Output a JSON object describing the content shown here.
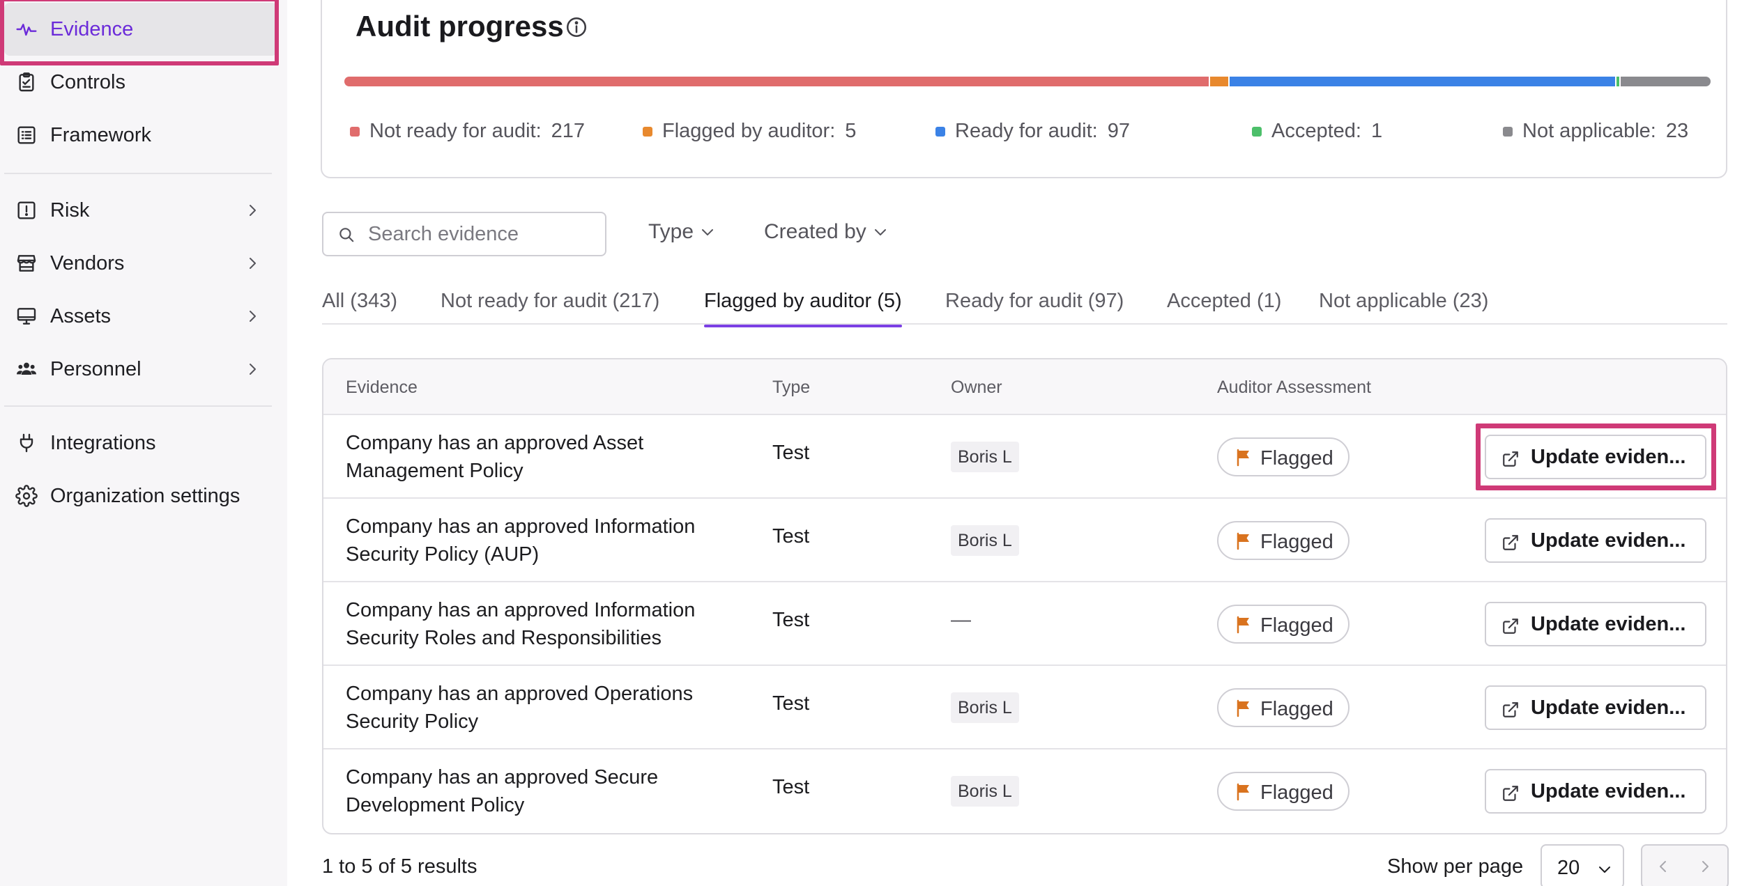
{
  "sidebar": {
    "items": [
      {
        "label": "Evidence",
        "icon": "activity-icon",
        "active": true
      },
      {
        "label": "Controls",
        "icon": "clipboard-check-icon"
      },
      {
        "label": "Framework",
        "icon": "list-grid-icon"
      },
      {
        "label": "Risk",
        "icon": "alert-square-icon",
        "has_chevron": true
      },
      {
        "label": "Vendors",
        "icon": "store-icon",
        "has_chevron": true
      },
      {
        "label": "Assets",
        "icon": "monitor-icon",
        "has_chevron": true
      },
      {
        "label": "Personnel",
        "icon": "users-icon",
        "has_chevron": true
      },
      {
        "label": "Integrations",
        "icon": "plug-icon"
      },
      {
        "label": "Organization settings",
        "icon": "gear-icon"
      }
    ]
  },
  "audit": {
    "title": "Audit progress",
    "legend": [
      {
        "label": "Not ready for audit:",
        "value": "217",
        "count": 217,
        "color": "#e06c6c"
      },
      {
        "label": "Flagged by auditor:",
        "value": "5",
        "count": 5,
        "color": "#e8892e"
      },
      {
        "label": "Ready for audit:",
        "value": "97",
        "count": 97,
        "color": "#3b82e6"
      },
      {
        "label": "Accepted:",
        "value": "1",
        "count": 1,
        "color": "#4cbf6a"
      },
      {
        "label": "Not applicable:",
        "value": "23",
        "count": 23,
        "color": "#8a8a8e"
      }
    ]
  },
  "filters": {
    "search_placeholder": "Search evidence",
    "type_label": "Type",
    "created_by_label": "Created by"
  },
  "tabs": [
    {
      "label": "All (343)"
    },
    {
      "label": "Not ready for audit (217)"
    },
    {
      "label": "Flagged by auditor (5)",
      "active": true
    },
    {
      "label": "Ready for audit (97)"
    },
    {
      "label": "Accepted (1)"
    },
    {
      "label": "Not applicable (23)"
    }
  ],
  "table": {
    "columns": [
      "Evidence",
      "Type",
      "Owner",
      "Auditor Assessment"
    ],
    "rows": [
      {
        "evidence": "Company has an approved Asset Management Policy",
        "type": "Test",
        "owner": "Boris L",
        "assessment": "Flagged",
        "action": "Update eviden..."
      },
      {
        "evidence": "Company has an approved Information Security Policy (AUP)",
        "type": "Test",
        "owner": "Boris L",
        "assessment": "Flagged",
        "action": "Update eviden..."
      },
      {
        "evidence": "Company has an approved Information Security Roles and Responsibilities",
        "type": "Test",
        "owner": "—",
        "assessment": "Flagged",
        "action": "Update eviden..."
      },
      {
        "evidence": "Company has an approved Operations Security Policy",
        "type": "Test",
        "owner": "Boris L",
        "assessment": "Flagged",
        "action": "Update eviden..."
      },
      {
        "evidence": "Company has an approved Secure Development Policy",
        "type": "Test",
        "owner": "Boris L",
        "assessment": "Flagged",
        "action": "Update eviden..."
      }
    ]
  },
  "footer": {
    "results": "1 to 5 of 5 results",
    "per_page_label": "Show per page",
    "per_page_value": "20"
  },
  "colors": {
    "accent": "#6b2bd9",
    "highlight": "#cf3a77",
    "flag": "#d9731f"
  }
}
